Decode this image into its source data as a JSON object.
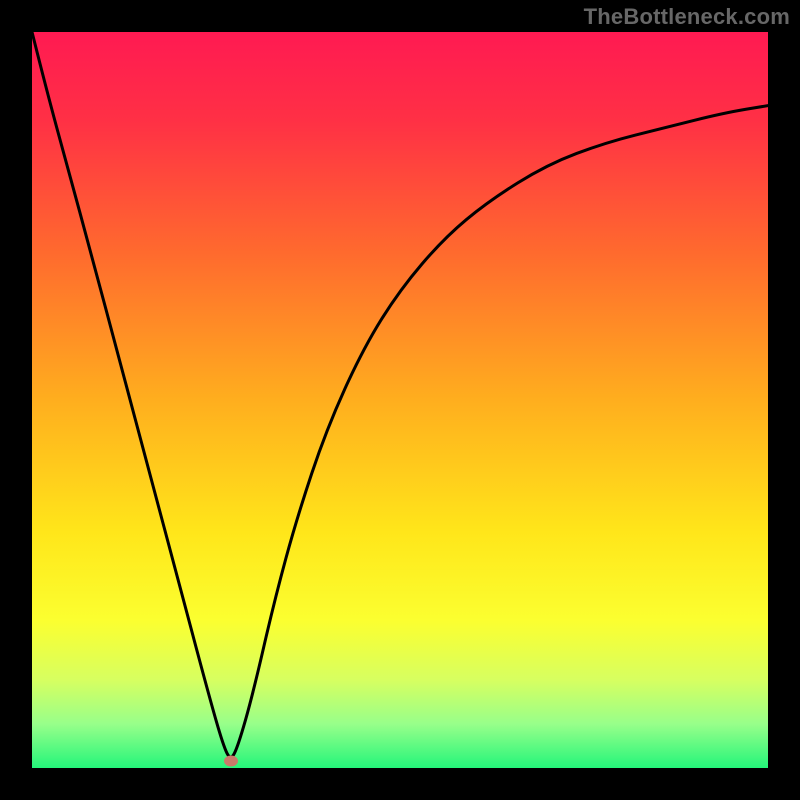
{
  "watermark": {
    "text": "TheBottleneck.com"
  },
  "chart_data": {
    "type": "line",
    "title": "",
    "xlabel": "",
    "ylabel": "",
    "xlim": [
      0,
      100
    ],
    "ylim": [
      0,
      100
    ],
    "background": {
      "type": "vertical_gradient",
      "stops": [
        {
          "pct": 0,
          "color": "#ff1a52"
        },
        {
          "pct": 12,
          "color": "#ff3045"
        },
        {
          "pct": 30,
          "color": "#ff6a2e"
        },
        {
          "pct": 50,
          "color": "#ffae1e"
        },
        {
          "pct": 68,
          "color": "#ffe61a"
        },
        {
          "pct": 80,
          "color": "#fbff30"
        },
        {
          "pct": 88,
          "color": "#d7ff60"
        },
        {
          "pct": 94,
          "color": "#98ff8a"
        },
        {
          "pct": 100,
          "color": "#24f57a"
        }
      ]
    },
    "series": [
      {
        "name": "bottleneck-curve",
        "color": "#000000",
        "x": [
          0,
          2,
          5,
          8,
          12,
          16,
          20,
          24,
          26,
          27,
          28,
          30,
          33,
          36,
          40,
          45,
          50,
          56,
          62,
          70,
          78,
          86,
          94,
          100
        ],
        "values": [
          100,
          92,
          81,
          70,
          55,
          40,
          25,
          10,
          3,
          1,
          3,
          10,
          23,
          34,
          46,
          57,
          65,
          72,
          77,
          82,
          85,
          87,
          89,
          90
        ]
      }
    ],
    "minimum_point": {
      "x": 27,
      "y": 1,
      "label": ""
    },
    "legend": {
      "visible": false
    },
    "grid": false
  },
  "colors": {
    "frame": "#000000",
    "curve": "#000000",
    "marker": "#c97b6a"
  }
}
